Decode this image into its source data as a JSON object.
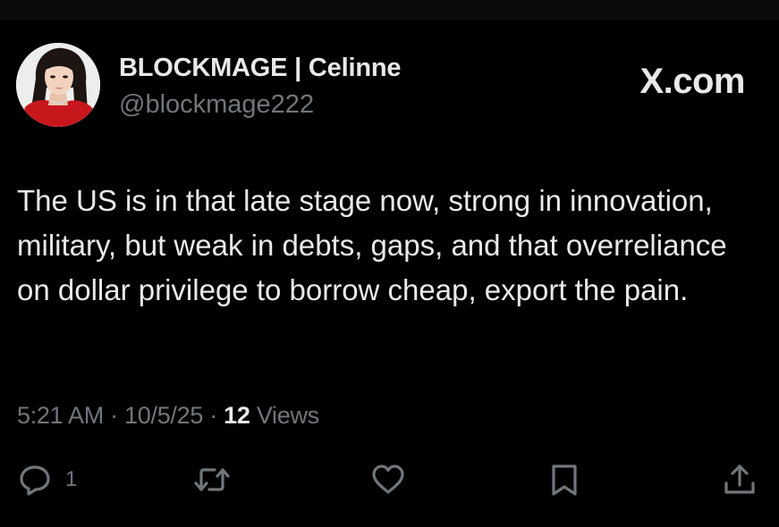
{
  "tweet": {
    "author": {
      "display_name": "BLOCKMAGE | Celinne",
      "handle": "@blockmage222"
    },
    "brand": "X.com",
    "text": "The US is in that late stage now, strong in innovation, military, but weak in debts, gaps, and that overreliance on dollar privilege to borrow cheap, export the pain.",
    "time": "5:21 AM",
    "date": "10/5/25",
    "separator": "·",
    "views_count": "12",
    "views_label": "Views",
    "actions": {
      "reply_count": "1",
      "icons": [
        "reply-icon",
        "retweet-icon",
        "like-icon",
        "bookmark-icon",
        "share-icon"
      ]
    }
  },
  "colors": {
    "background": "#000000",
    "primary_text": "#e7e9ea",
    "secondary_text": "#71767b"
  }
}
